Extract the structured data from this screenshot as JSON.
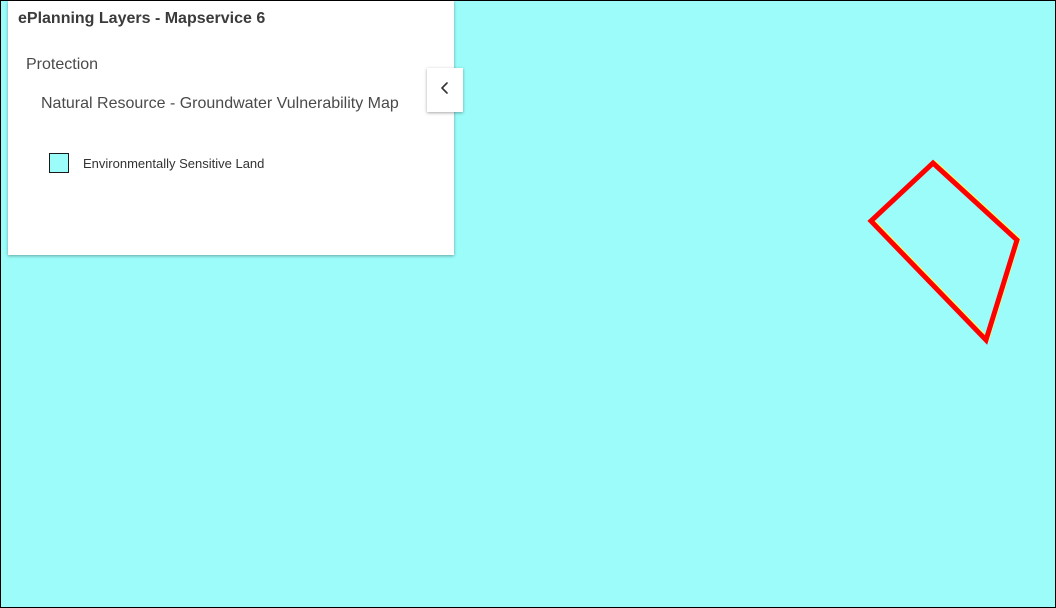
{
  "panel": {
    "title": "ePlanning Layers - Mapservice 6",
    "group_label": "Protection",
    "layer_label": "Natural Resource - Groundwater Vulnerability Map",
    "legend_items": [
      {
        "label": "Environmentally Sensitive Land",
        "color": "#9bfcf9"
      }
    ],
    "collapse_icon": "chevron-left-icon"
  },
  "map": {
    "background_color": "#9bfcf9",
    "parcel_outline_color": "#ff0000",
    "parcel_highlight_color": "#ffff66"
  }
}
